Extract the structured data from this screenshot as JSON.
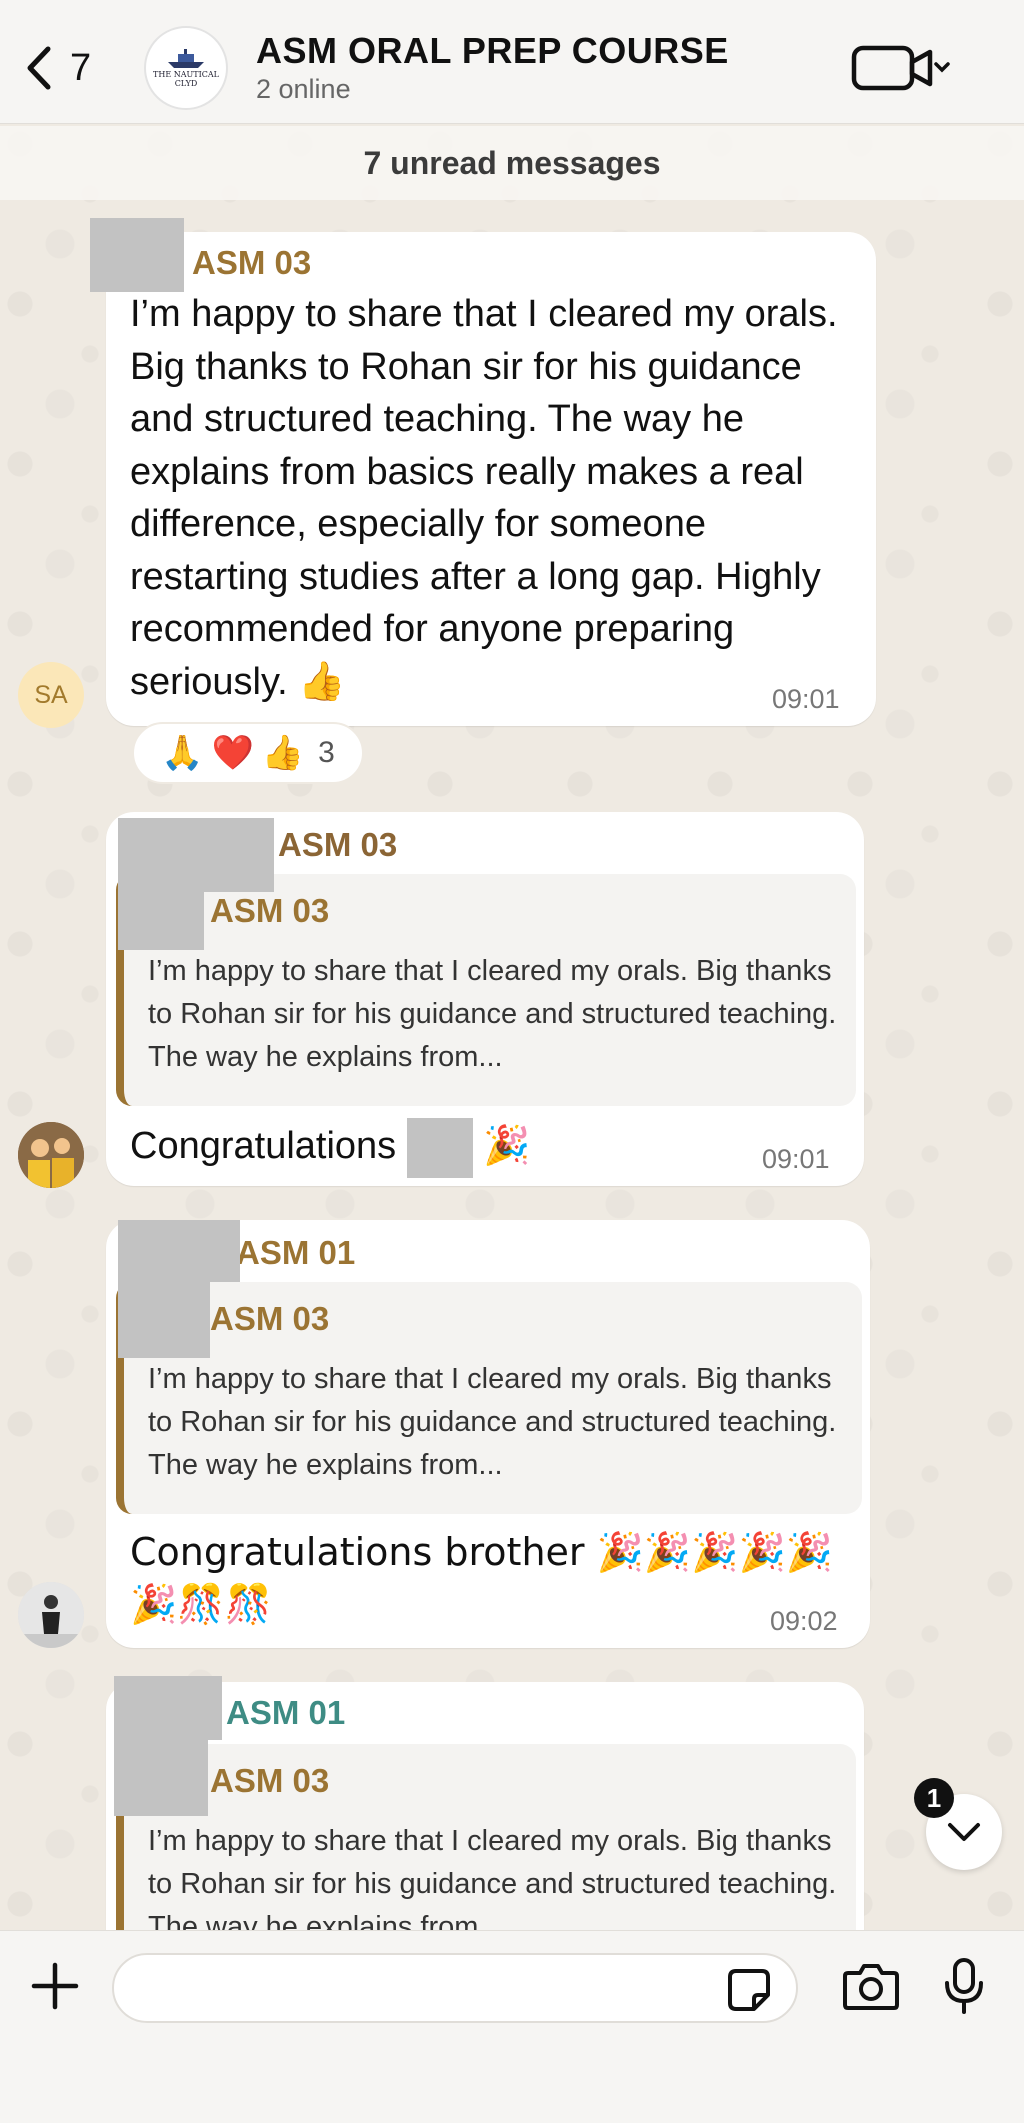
{
  "header": {
    "back_count": "7",
    "title": "ASM ORAL PREP COURSE",
    "subtitle": "2 online",
    "logo_text_top": "THE NAUTICAL",
    "logo_text_bottom": "CLYD"
  },
  "unread_banner": "7 unread messages",
  "messages": [
    {
      "sender": "ASM 03",
      "avatar_initials": "SA",
      "text": "I’m happy to share that I cleared my orals. Big thanks to Rohan sir for his guidance and structured teaching. The way he explains from basics really makes a real difference, especially for someone restarting studies after a long gap. Highly recommended for anyone preparing seriously. 👍",
      "time": "09:01",
      "reactions": [
        "🙏",
        "❤️",
        "👍"
      ],
      "reaction_count": "3"
    },
    {
      "sender": "ASM 03",
      "quote_sender": "ASM 03",
      "quote_text": "I’m happy to share that I cleared my orals. Big thanks to Rohan sir for his guidance and structured teaching. The way he explains from...",
      "text": "Congratulations",
      "text_emoji": "🎉",
      "time": "09:01"
    },
    {
      "sender": "ASM 01",
      "quote_sender": "ASM 03",
      "quote_text": "I’m happy to share that I cleared my orals. Big thanks to Rohan sir for his guidance and structured teaching. The way he explains from...",
      "text": "Congratulations brother 🎉🎉🎉🎉🎉",
      "text_line2": "🎉🎊🎊",
      "time": "09:02"
    },
    {
      "sender": "ASM 01",
      "quote_sender": "ASM 03",
      "quote_text": "I’m happy to share that I cleared my orals. Big thanks to Rohan sir for his guidance and structured teaching. The way he explains from..."
    }
  ],
  "scroll_badge": "1",
  "composer": {
    "value": "",
    "placeholder": ""
  },
  "colors": {
    "accent_brown": "#9b7433",
    "accent_teal": "#3e8c84",
    "wallpaper": "#efeae2"
  }
}
